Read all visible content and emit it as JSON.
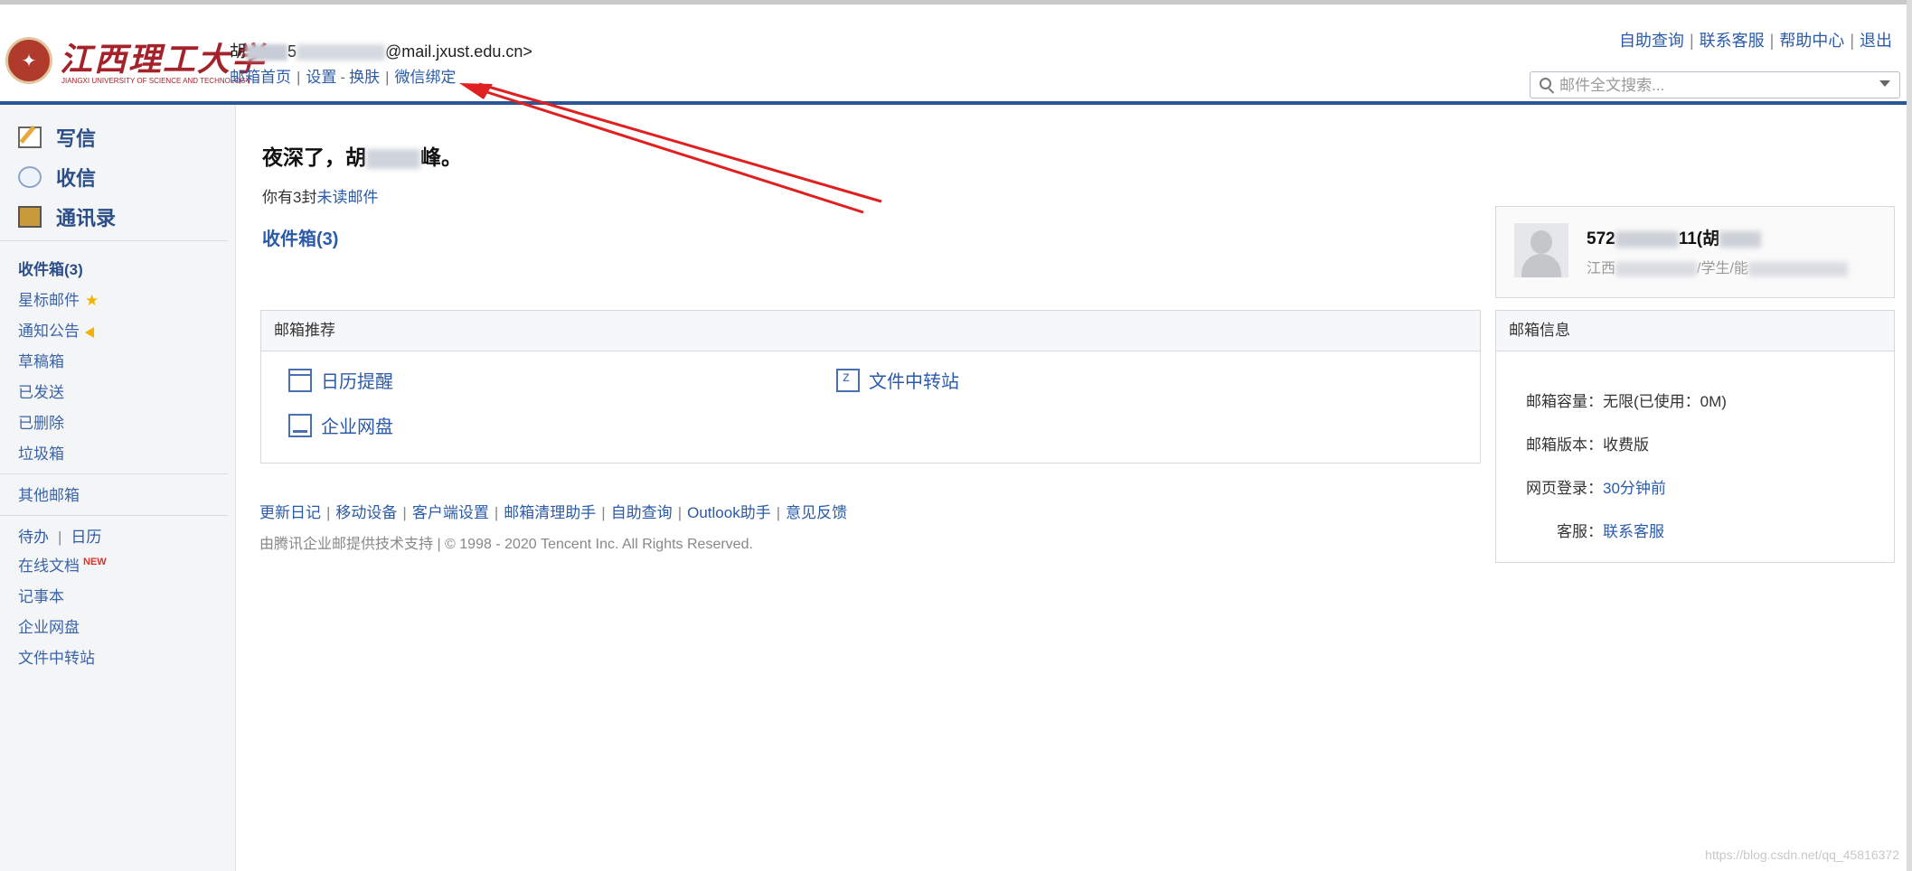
{
  "header": {
    "logo": {
      "cn": "江西理工大学",
      "en": "JIANGXI UNIVERSITY OF SCIENCE AND TECHNOLOGY"
    },
    "user_prefix": "胡",
    "user_mid": "5",
    "user_suffix": "@mail.jxust.edu.cn>",
    "nav": [
      "邮箱首页",
      "设置",
      "换肤",
      "微信绑定"
    ],
    "top_right": [
      "自助查询",
      "联系客服",
      "帮助中心",
      "退出"
    ],
    "search_placeholder": "邮件全文搜索..."
  },
  "sidebar": {
    "big_items": [
      "写信",
      "收信",
      "通讯录"
    ],
    "folders": [
      "收件箱(3)",
      "星标邮件",
      "通知公告",
      "草稿箱",
      "已发送",
      "已删除",
      "垃圾箱"
    ],
    "other_mailbox": "其他邮箱",
    "todo": "待办",
    "calendar": "日历",
    "tools": [
      "在线文档",
      "记事本",
      "企业网盘",
      "文件中转站"
    ],
    "new_badge": "NEW"
  },
  "main": {
    "greeting_prefix": "夜深了，",
    "greeting_name_visible": "胡",
    "greeting_suffix": "峰。",
    "unread_prefix": "你有3封",
    "unread_link": "未读邮件",
    "inbox_title": "收件箱(3)",
    "recommend": {
      "title": "邮箱推荐",
      "items": [
        "日历提醒",
        "文件中转站",
        "企业网盘"
      ]
    },
    "footer_links": [
      "更新日记",
      "移动设备",
      "客户端设置",
      "邮箱清理助手",
      "自助查询",
      "Outlook助手",
      "意见反馈"
    ],
    "copyright": "由腾讯企业邮提供技术支持  | © 1998 - 2020 Tencent Inc. All Rights Reserved."
  },
  "profile": {
    "name_visible_prefix": "572",
    "name_visible_suffix": "11(胡",
    "dept_prefix": "江西",
    "dept_suffix": "/学生/能"
  },
  "mailbox_info": {
    "title": "邮箱信息",
    "rows": [
      {
        "label": "邮箱容量：",
        "value": "无限(已使用：0M)"
      },
      {
        "label": "邮箱版本：",
        "value": "收费版"
      },
      {
        "label": "网页登录：",
        "value": "30分钟前"
      },
      {
        "label": "客服：",
        "value": "联系客服"
      }
    ]
  },
  "watermark": "https://blog.csdn.net/qq_45816372",
  "colors": {
    "accent": "#2b5597",
    "link": "#2b5ba8",
    "arrow": "#e02020"
  }
}
